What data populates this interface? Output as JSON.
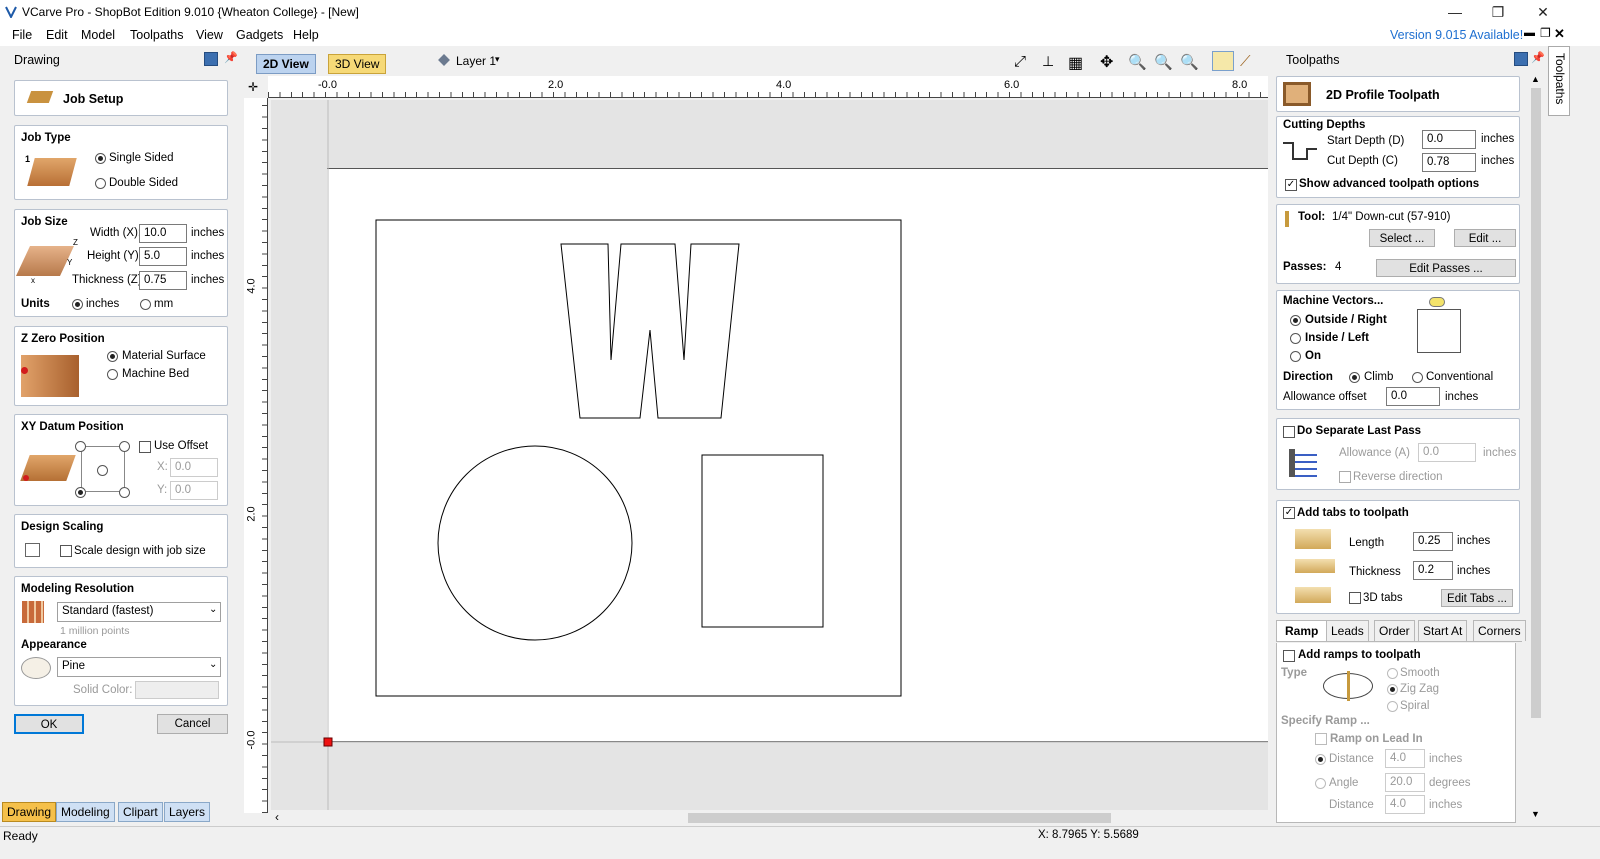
{
  "window": {
    "title": "VCarve Pro - ShopBot Edition 9.010 {Wheaton College} - [New]",
    "minimize": "—",
    "maximize": "❐",
    "close": "✕"
  },
  "menu": [
    "File",
    "Edit",
    "Model",
    "Toolpaths",
    "View",
    "Gadgets",
    "Help"
  ],
  "version_notice": "Version 9.015 Available!",
  "left_panel": {
    "header": "Drawing",
    "job_setup": "Job Setup",
    "job_type": {
      "title": "Job Type",
      "single": "Single Sided",
      "double": "Double Sided",
      "selected": "Single Sided"
    },
    "job_size": {
      "title": "Job Size",
      "width_label": "Width (X):",
      "width": "10.0",
      "height_label": "Height (Y):",
      "height": "5.0",
      "thickness_label": "Thickness (Z):",
      "thickness": "0.75",
      "unit": "inches",
      "units_label": "Units",
      "inches": "inches",
      "mm": "mm",
      "selected_units": "inches"
    },
    "z_zero": {
      "title": "Z Zero Position",
      "material": "Material Surface",
      "bed": "Machine Bed",
      "selected": "Material Surface"
    },
    "xy_datum": {
      "title": "XY Datum Position",
      "use_offset": "Use Offset",
      "x_label": "X:",
      "x": "0.0",
      "y_label": "Y:",
      "y": "0.0"
    },
    "design_scaling": {
      "title": "Design Scaling",
      "scale": "Scale design with job size"
    },
    "modeling": {
      "title": "Modeling Resolution",
      "value": "Standard (fastest)",
      "note": "1 million points"
    },
    "appearance": {
      "title": "Appearance",
      "value": "Pine",
      "solid_label": "Solid Color:"
    },
    "ok": "OK",
    "cancel": "Cancel",
    "bottom_tabs": [
      "Drawing",
      "Modeling",
      "Clipart",
      "Layers"
    ]
  },
  "view": {
    "tab_2d": "2D View",
    "tab_3d": "3D View",
    "layer": "Layer 1",
    "ruler_h": [
      "-0.0",
      "2.0",
      "4.0",
      "6.0",
      "8.0"
    ],
    "ruler_v": [
      "4.0",
      "2.0",
      "-0.0"
    ],
    "status": "Ready",
    "coords": "X: 8.7965 Y: 5.5689"
  },
  "right_panel": {
    "header": "Toolpaths",
    "side_tab": "Toolpaths",
    "title": "2D Profile Toolpath",
    "cutting": {
      "title": "Cutting Depths",
      "start_label": "Start Depth (D)",
      "start": "0.0",
      "cut_label": "Cut Depth (C)",
      "cut": "0.78",
      "unit": "inches",
      "advanced": "Show advanced toolpath options"
    },
    "tool": {
      "label": "Tool:",
      "value": "1/4\" Down-cut (57-910)",
      "select": "Select ...",
      "edit": "Edit ...",
      "passes_label": "Passes:",
      "passes": "4",
      "edit_passes": "Edit Passes ..."
    },
    "machine": {
      "title": "Machine Vectors...",
      "outside": "Outside / Right",
      "inside": "Inside / Left",
      "on": "On",
      "direction": "Direction",
      "climb": "Climb",
      "conventional": "Conventional",
      "allowance_label": "Allowance offset",
      "allowance": "0.0",
      "unit": "inches"
    },
    "last_pass": {
      "title": "Do Separate Last Pass",
      "allowance_label": "Allowance (A)",
      "allowance": "0.0",
      "unit": "inches",
      "reverse": "Reverse direction"
    },
    "tabs": {
      "title": "Add tabs to toolpath",
      "length_label": "Length",
      "length": "0.25",
      "thickness_label": "Thickness",
      "thickness": "0.2",
      "unit": "inches",
      "tabs3d": "3D tabs",
      "edit": "Edit Tabs ..."
    },
    "subtabs": [
      "Ramp",
      "Leads",
      "Order",
      "Start At",
      "Corners"
    ],
    "ramp": {
      "add": "Add ramps to toolpath",
      "type": "Type",
      "smooth": "Smooth",
      "zigzag": "Zig Zag",
      "spiral": "Spiral",
      "specify": "Specify Ramp ...",
      "lead_in": "Ramp on Lead In",
      "distance": "Distance",
      "distance_val": "4.0",
      "angle": "Angle",
      "angle_val": "20.0",
      "distance2": "Distance",
      "distance2_val": "4.0",
      "inches": "inches",
      "degrees": "degrees"
    }
  }
}
